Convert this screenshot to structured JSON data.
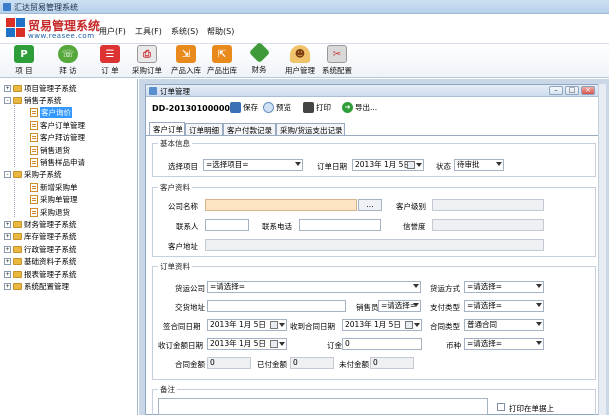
{
  "window": {
    "title": "汇达贸易管理系统"
  },
  "logo": {
    "name": "贸易管理系统",
    "url": "www.reasee.com"
  },
  "menu": [
    "用户(F)",
    "工具(F)",
    "系统(S)",
    "帮助(S)"
  ],
  "toolbar": [
    {
      "label": "项 目",
      "icon": "project-icon",
      "color": "#2e9e3a"
    },
    {
      "label": "拜 访",
      "icon": "visit-icon",
      "color": "#56a83a"
    },
    {
      "label": "订 单",
      "icon": "order-icon",
      "color": "#d33"
    },
    {
      "label": "采购订单",
      "icon": "purchase-order-icon",
      "color": "#6b6b6b"
    },
    {
      "label": "产品入库",
      "icon": "stock-in-icon",
      "color": "#e98b1c"
    },
    {
      "label": "产品出库",
      "icon": "stock-out-icon",
      "color": "#e98b1c"
    },
    {
      "label": "财务",
      "icon": "finance-icon",
      "color": "#3f9b3a"
    },
    {
      "label": "用户管理",
      "icon": "user-management-icon",
      "color": "#c98a2c"
    },
    {
      "label": "系统配置",
      "icon": "system-config-icon",
      "color": "#7a7a7a"
    }
  ],
  "tree": {
    "items": [
      {
        "label": "项目管理子系统",
        "type": "folder",
        "level": 0,
        "expander": "+"
      },
      {
        "label": "销售子系统",
        "type": "folder",
        "level": 0,
        "expander": "-"
      },
      {
        "label": "客户询价",
        "type": "doc",
        "level": 1
      },
      {
        "label": "客户订单管理",
        "type": "doc",
        "level": 1
      },
      {
        "label": "客户拜访管理",
        "type": "doc",
        "level": 1
      },
      {
        "label": "销售退货",
        "type": "doc",
        "level": 1
      },
      {
        "label": "销售样品申请",
        "type": "doc",
        "level": 1
      },
      {
        "label": "采购子系统",
        "type": "folder",
        "level": 0,
        "expander": "-"
      },
      {
        "label": "新增采购单",
        "type": "doc",
        "level": 1
      },
      {
        "label": "采购单管理",
        "type": "doc",
        "level": 1
      },
      {
        "label": "采购退货",
        "type": "doc",
        "level": 1
      },
      {
        "label": "财务管理子系统",
        "type": "folder",
        "level": 0,
        "expander": "+"
      },
      {
        "label": "库存管理子系统",
        "type": "folder",
        "level": 0,
        "expander": "+"
      },
      {
        "label": "行政管理子系统",
        "type": "folder",
        "level": 0,
        "expander": "+"
      },
      {
        "label": "基础资料子系统",
        "type": "folder",
        "level": 0,
        "expander": "+"
      },
      {
        "label": "报表管理子系统",
        "type": "folder",
        "level": 0,
        "expander": "+"
      },
      {
        "label": "系统配置管理",
        "type": "folder",
        "level": 0,
        "expander": "+"
      }
    ],
    "selected": "客户询价"
  },
  "inner_window": {
    "title": "订单管理"
  },
  "order": {
    "number": "DD-201301000001",
    "actions": [
      "保存",
      "预览",
      "打印",
      "导出..."
    ]
  },
  "tabs": [
    "客户订单",
    "订单明细",
    "客户付款记录",
    "采购/货运支出记录"
  ],
  "basic": {
    "title": "基本信息",
    "select_project_label": "选择项目",
    "select_project_value": "=选择项目=",
    "order_date_label": "订单日期",
    "order_date_value": "2013年 1月 5日",
    "status_label": "状态",
    "status_value": "待审批"
  },
  "customer": {
    "title": "客户资料",
    "company_label": "公司名称",
    "company_btn": "...",
    "level_label": "客户级别",
    "contact_label": "联系人",
    "phone_label": "联系电话",
    "credit_label": "信誉度",
    "address_label": "客户地址"
  },
  "orderinfo": {
    "title": "订单资料",
    "freight_company_label": "货运公司",
    "freight_company_value": "=请选择=",
    "shipping_method_label": "货运方式",
    "shipping_method_value": "=请选择=",
    "delivery_addr_label": "交货地址",
    "salesman_label": "销售员",
    "salesman_value": "=请选择=",
    "payment_type_label": "支付类型",
    "payment_type_value": "=请选择=",
    "sign_date_label": "签合同日期",
    "sign_date_value": "2013年 1月 5日",
    "receive_date_label": "收到合同日期",
    "receive_date_value": "2013年 1月 5日",
    "contract_type_label": "合同类型",
    "contract_type_value": "普通合同",
    "receipt_date_label": "收订金额日期",
    "receipt_date_value": "2013年 1月 5日",
    "deposit_label": "订金",
    "deposit_value": "0",
    "currency_label": "币种",
    "currency_value": "=请选择=",
    "contract_amount_label": "合同金额",
    "contract_amount_value": "0",
    "paid_label": "已付金额",
    "paid_value": "0",
    "unpaid_label": "未付金额",
    "unpaid_value": "0"
  },
  "remark": {
    "title": "备注",
    "print_label": "打印在单据上"
  }
}
